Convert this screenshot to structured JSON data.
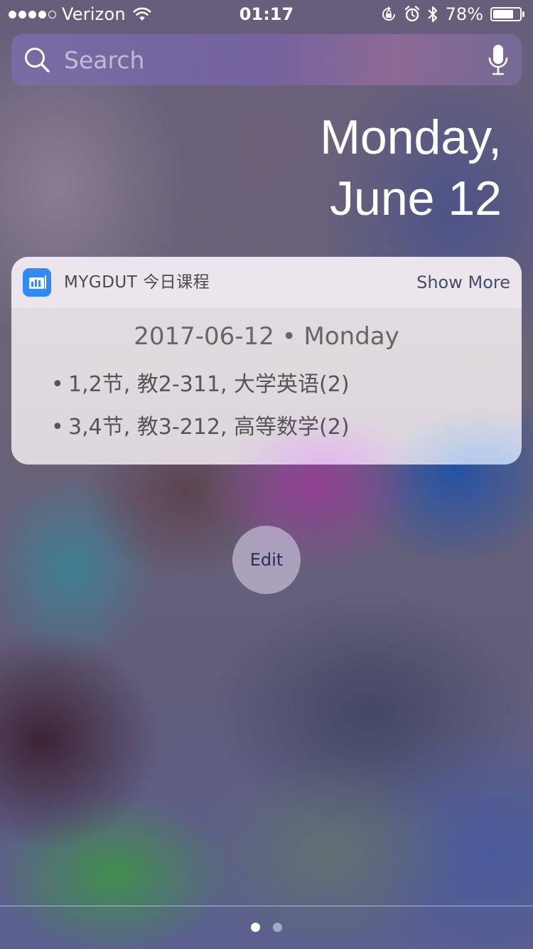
{
  "status_bar": {
    "carrier": "Verizon",
    "signal_bars_filled": 4,
    "signal_bars_total": 5,
    "time": "01:17",
    "battery_percent": "78%",
    "battery_level": 0.78,
    "icons": [
      "wifi-icon",
      "orientation-lock-icon",
      "alarm-icon",
      "bluetooth-icon",
      "battery-icon"
    ]
  },
  "search": {
    "placeholder": "Search",
    "value": ""
  },
  "date": {
    "line1": "Monday,",
    "line2": "June 12"
  },
  "widget": {
    "app_name": "MYGDUT 今日课程",
    "show_more_label": "Show More",
    "date_line": "2017-06-12 • Monday",
    "bullet": "•",
    "courses": [
      "1,2节, 教2-311, 大学英语(2)",
      "3,4节, 教3-212, 高等数学(2)"
    ],
    "accent_color": "#2f8af5"
  },
  "edit_button": {
    "label": "Edit"
  },
  "pager": {
    "current_page": 1,
    "page_count": 2
  }
}
